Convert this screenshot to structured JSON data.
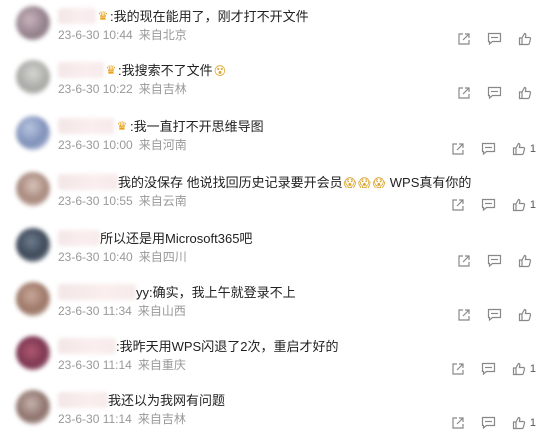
{
  "comments": [
    {
      "text": ":我的现在能用了，刚才打不开文件",
      "date": "23-6-30 10:44",
      "location": "来自北京",
      "likes": "",
      "crown": true,
      "emoji_count": 0
    },
    {
      "text": ":我搜索不了文件",
      "date": "23-6-30 10:22",
      "location": "来自吉林",
      "likes": "",
      "crown": true,
      "emoji_count": 1
    },
    {
      "text": ":我一直打不开思维导图",
      "date": "23-6-30 10:00",
      "location": "来自河南",
      "likes": "1",
      "crown": true,
      "emoji_count": 0
    },
    {
      "text": "我的没保存 他说找回历史记录要开会员",
      "text_after": " WPS真有你的",
      "date": "23-6-30 10:55",
      "location": "来自云南",
      "likes": "1",
      "crown": false,
      "emoji_count": 3
    },
    {
      "text": "所以还是用Microsoft365吧",
      "date": "23-6-30 10:40",
      "location": "来自四川",
      "likes": "",
      "crown": false,
      "emoji_count": 0
    },
    {
      "text": "yy:确实，我上午就登录不上",
      "date": "23-6-30 11:34",
      "location": "来自山西",
      "likes": "",
      "crown": false,
      "emoji_count": 0
    },
    {
      "text": ":我昨天用WPS闪退了2次，重启才好的",
      "date": "23-6-30 11:14",
      "location": "来自重庆",
      "likes": "1",
      "crown": false,
      "emoji_count": 0
    },
    {
      "text": "我还以为我网有问题",
      "date": "23-6-30 11:14",
      "location": "来自吉林",
      "likes": "1",
      "crown": false,
      "emoji_count": 0
    }
  ],
  "icons": {
    "share": "share-icon",
    "comment": "comment-icon",
    "like": "like-icon"
  }
}
